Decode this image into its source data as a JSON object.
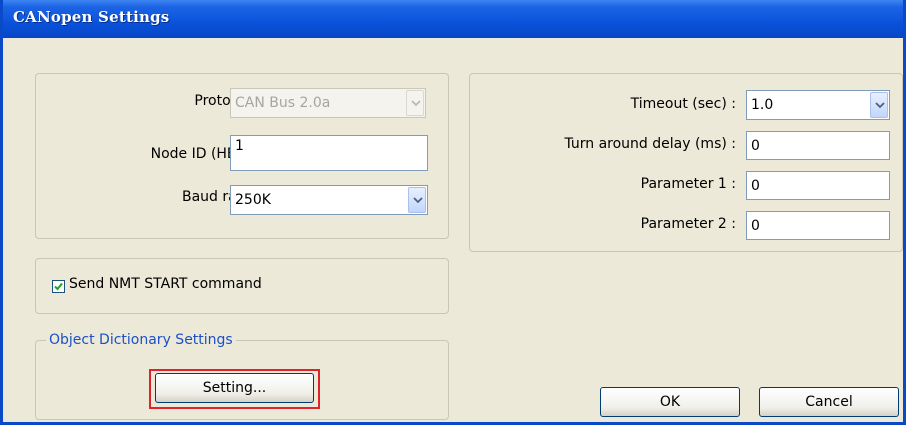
{
  "window": {
    "title": "CANopen Settings"
  },
  "connection": {
    "protocol_label": "Protocol :",
    "protocol_value": "CAN Bus 2.0a",
    "node_id_label": "Node ID (HEX) :",
    "node_id_value": "1",
    "baud_rate_label": "Baud rate :",
    "baud_rate_value": "250K"
  },
  "timing": {
    "timeout_label": "Timeout (sec) :",
    "timeout_value": "1.0",
    "turnaround_label": "Turn around delay (ms) :",
    "turnaround_value": "0",
    "param1_label": "Parameter 1 :",
    "param1_value": "0",
    "param2_label": "Parameter 2 :",
    "param2_value": "0"
  },
  "nmt": {
    "checkbox_label": "Send NMT START command",
    "checked": true
  },
  "object_dictionary": {
    "legend": "Object Dictionary Settings",
    "button_label": "Setting..."
  },
  "footer": {
    "ok_label": "OK",
    "cancel_label": "Cancel"
  },
  "colors": {
    "title_bar": "#0a52da",
    "legend_text": "#1b50c8",
    "highlight": "#e0232a"
  }
}
